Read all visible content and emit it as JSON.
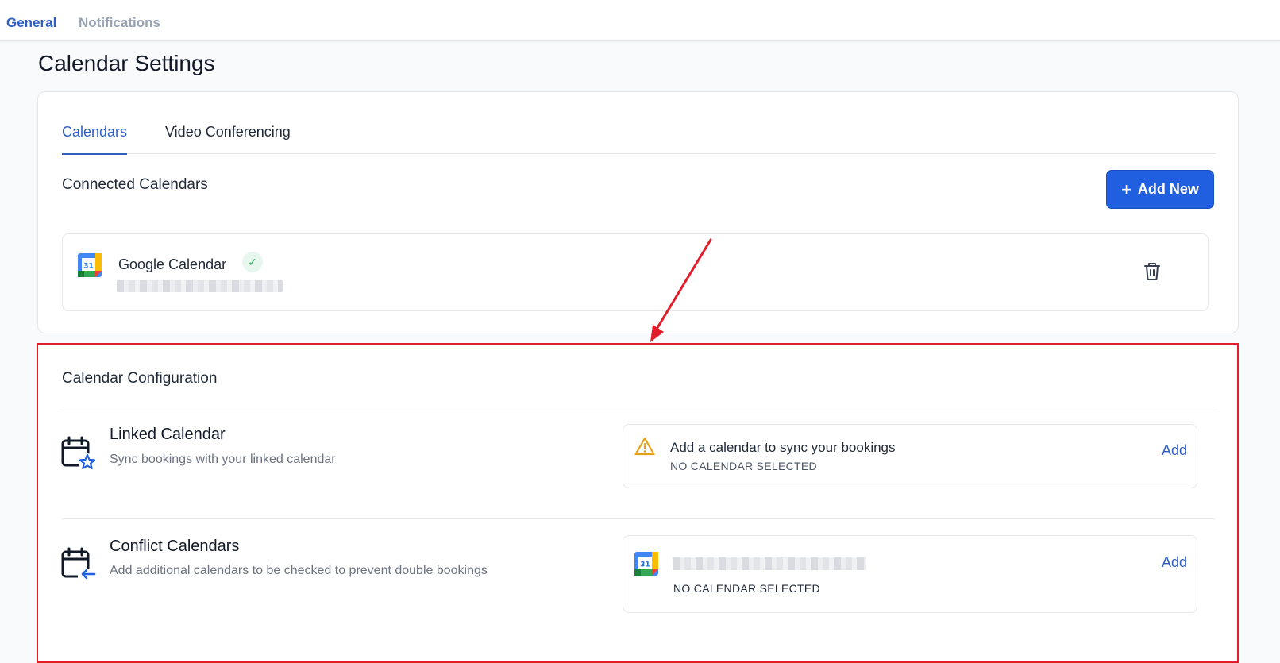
{
  "topnav": {
    "tabs": [
      "General",
      "Notifications"
    ]
  },
  "page_title": "Calendar Settings",
  "settings_tabs": [
    "Calendars",
    "Video Conferencing"
  ],
  "connected": {
    "title": "Connected Calendars",
    "add_button": "Add New",
    "item": {
      "name": "Google Calendar",
      "icon_text": "31"
    }
  },
  "config": {
    "title": "Calendar Configuration",
    "linked": {
      "title": "Linked Calendar",
      "subtitle": "Sync bookings with your linked calendar",
      "panel_main": "Add a calendar to sync your bookings",
      "panel_status": "NO CALENDAR SELECTED",
      "panel_action": "Add"
    },
    "conflict": {
      "title": "Conflict Calendars",
      "subtitle": "Add additional calendars to be checked to prevent double bookings",
      "panel_status": "NO CALENDAR SELECTED",
      "panel_action": "Add"
    }
  },
  "colors": {
    "accent": "#2f5fc4",
    "button": "#1f5fe0",
    "highlight": "#e11d2a",
    "success": "#22a55b",
    "warning": "#e6a117"
  },
  "icons": [
    "plus-icon",
    "check-icon",
    "google-calendar-icon",
    "trash-icon",
    "warning-icon",
    "calendar-star-icon",
    "calendar-arrow-icon"
  ]
}
